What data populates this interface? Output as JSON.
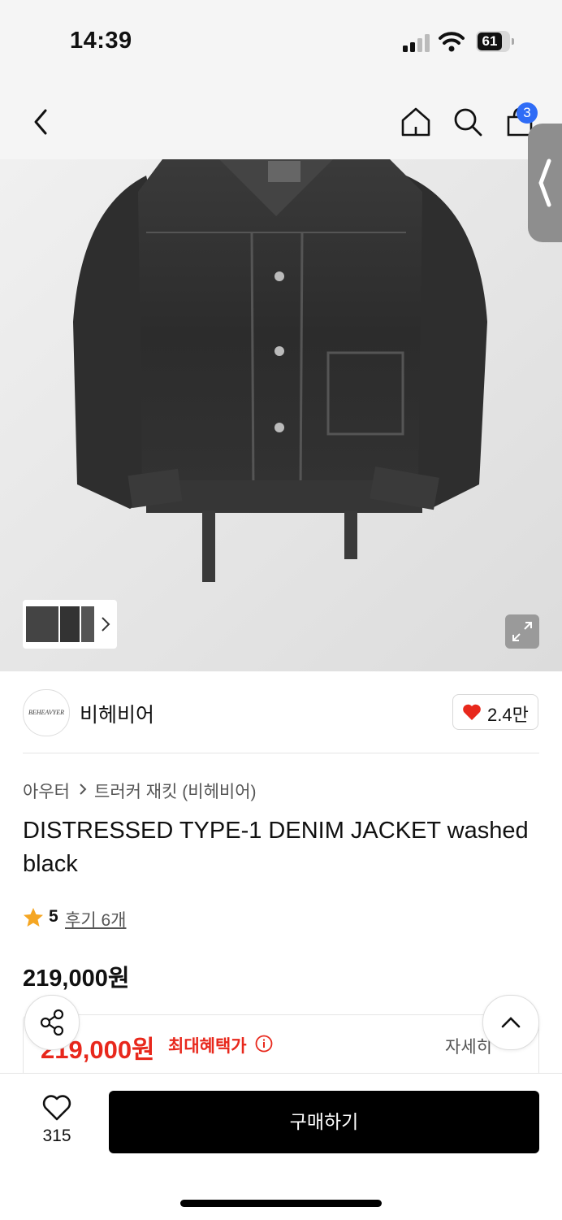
{
  "status_bar": {
    "time": "14:39",
    "battery": "61"
  },
  "header": {
    "cart_count": "3"
  },
  "brand": {
    "logo_text": "BEHEAVYER",
    "name": "비헤비어",
    "likes": "2.4만"
  },
  "breadcrumb": {
    "category": "아우터",
    "subcategory": "트러커 재킷 (비헤비어)"
  },
  "product": {
    "title": "DISTRESSED TYPE-1 DENIM JACKET washed black",
    "rating": "5",
    "reviews": "후기 6개",
    "price": "219,000원"
  },
  "benefit": {
    "price": "219,000원",
    "label": "최대혜택가",
    "detail": "자세히"
  },
  "bottom_bar": {
    "wish_count": "315",
    "buy_label": "구매하기"
  },
  "colors": {
    "accent_red": "#e8281c",
    "badge_blue": "#2f6cf6"
  }
}
